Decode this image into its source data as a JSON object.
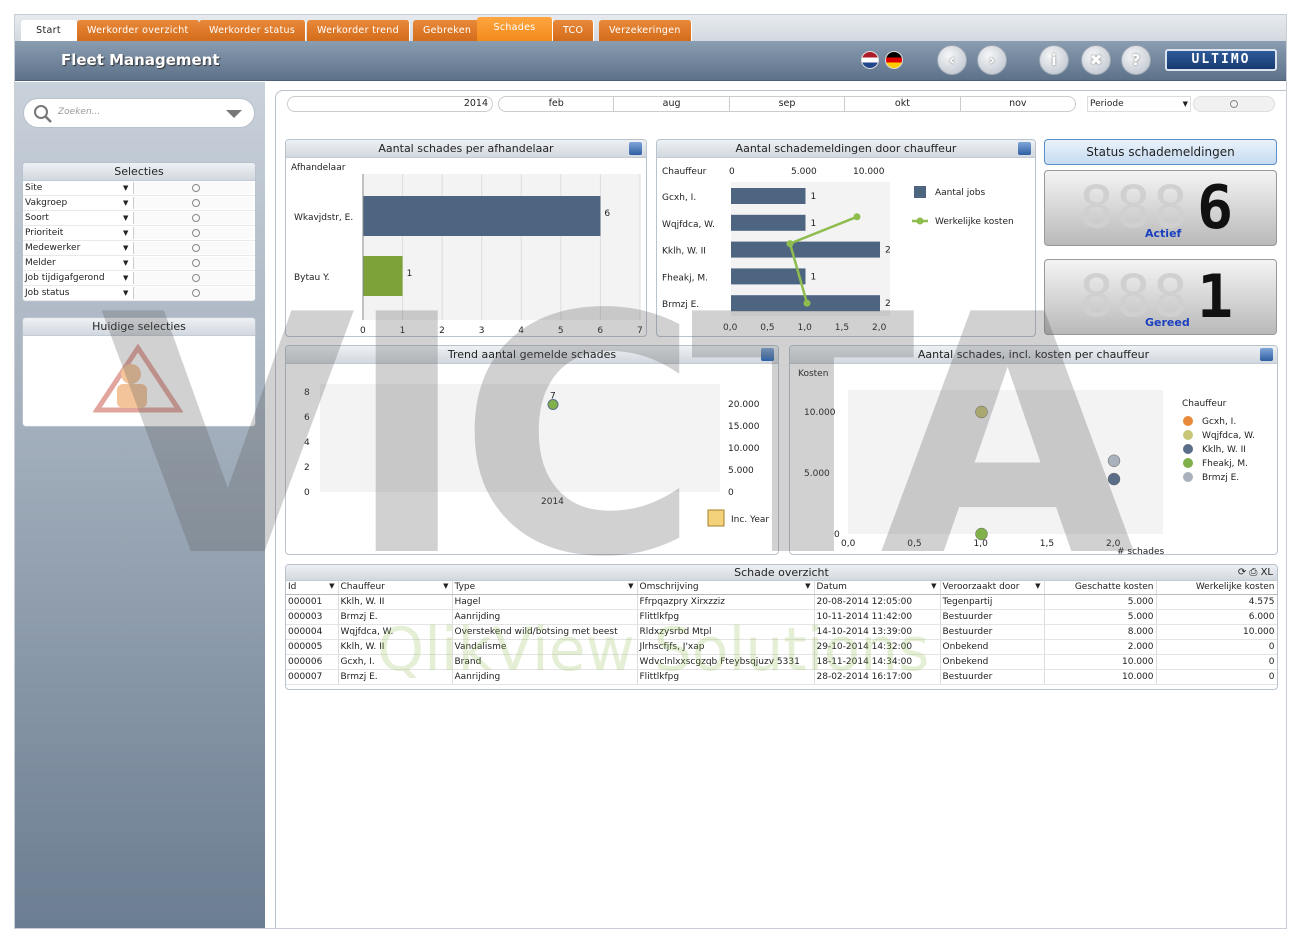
{
  "tabs": [
    "Start",
    "Werkorder overzicht",
    "Werkorder status",
    "Werkorder trend",
    "Gebreken",
    "Schades",
    "TCO",
    "Verzekeringen"
  ],
  "header": {
    "title": "Fleet Management",
    "brand": "ULTIMO"
  },
  "search": {
    "placeholder": "Zoeken..."
  },
  "selecties": {
    "title": "Selecties",
    "items": [
      "Site",
      "Vakgroep",
      "Soort",
      "Prioriteit",
      "Medewerker",
      "Melder",
      "Job tijdigafgerond",
      "Job status"
    ]
  },
  "huidige": {
    "title": "Huidige selecties"
  },
  "timeline": {
    "year": "2014",
    "months": [
      "feb",
      "aug",
      "sep",
      "okt",
      "nov"
    ],
    "periode": "Periode"
  },
  "status": {
    "title": "Status schademeldingen",
    "actief_label": "Actief",
    "actief_value": "6",
    "gereed_label": "Gereed",
    "gereed_value": "1"
  },
  "chart1": {
    "title": "Aantal schades per afhandelaar",
    "dim_label": "Afhandelaar",
    "chart_data": {
      "type": "bar",
      "orientation": "horizontal",
      "categories": [
        "Wkavjdstr, E.",
        "Bytau Y."
      ],
      "values": [
        6,
        1
      ],
      "xlim": [
        0,
        7
      ],
      "ticks": [
        "0",
        "1",
        "2",
        "3",
        "4",
        "5",
        "6",
        "7"
      ],
      "colors": [
        "#4e6582",
        "#7da23a"
      ]
    }
  },
  "chart2": {
    "title": "Aantal schademeldingen door chauffeur",
    "dim_label": "Chauffeur",
    "chart_data": {
      "type": "bar",
      "orientation": "horizontal",
      "categories": [
        "Gcxh, I.",
        "Wqjfdca, W.",
        "Kklh, W. II",
        "Fheakj, M.",
        "Brmzj E."
      ],
      "series": [
        {
          "name": "Aantal jobs",
          "values": [
            1,
            1,
            2,
            1,
            2
          ]
        },
        {
          "name": "Werkelijke kosten",
          "values": [
            null,
            10000,
            5000,
            null,
            0
          ]
        }
      ],
      "bottom_ticks": [
        "0,0",
        "0,5",
        "1,0",
        "1,5",
        "2,0"
      ],
      "top_ticks": [
        "0",
        "5.000",
        "10.000"
      ]
    }
  },
  "chart3": {
    "title": "Trend aantal gemelde schades",
    "chart_data": {
      "type": "scatter",
      "x": [
        "2014"
      ],
      "values": [
        7
      ],
      "left_ticks": [
        "0",
        "2",
        "4",
        "6",
        "8"
      ],
      "right_ticks": [
        "0",
        "5.000",
        "10.000",
        "15.000",
        "20.000"
      ]
    },
    "cycle_label": "Inc. Year"
  },
  "chart4": {
    "title": "Aantal schades, incl. kosten per chauffeur",
    "ylabel": "Kosten",
    "xlabel": "# schades",
    "legend_title": "Chauffeur",
    "chart_data": {
      "type": "scatter",
      "series": [
        {
          "name": "Gcxh, I.",
          "color": "#e9893a",
          "x": null,
          "y": null
        },
        {
          "name": "Wqjfdca, W.",
          "color": "#c9c67a",
          "x": 1,
          "y": 10000
        },
        {
          "name": "Kklh, W. II",
          "color": "#5a6e8a",
          "x": 2,
          "y": 4500
        },
        {
          "name": "Fheakj, M.",
          "color": "#7fb04a",
          "x": 1,
          "y": 0
        },
        {
          "name": "Brmzj E.",
          "color": "#a9b1bd",
          "x": 2,
          "y": 6000
        }
      ],
      "x_ticks": [
        "0,0",
        "0,5",
        "1,0",
        "1,5",
        "2,0"
      ],
      "y_ticks": [
        "0",
        "5.000",
        "10.000"
      ]
    }
  },
  "table": {
    "title": "Schade overzicht",
    "export_label": "XL",
    "columns": [
      "Id",
      "Chauffeur",
      "Type",
      "Omschrijving",
      "Datum",
      "Veroorzaakt door",
      "Geschatte kosten",
      "Werkelijke kosten"
    ],
    "rows": [
      [
        "000001",
        "Kklh, W. II",
        "Hagel",
        "Ffrpqazpry Xirxzziz",
        "20-08-2014 12:05:00",
        "Tegenpartij",
        "5.000",
        "4.575"
      ],
      [
        "000003",
        "Brmzj E.",
        "Aanrijding",
        "Flittlkfpg",
        "10-11-2014 11:42:00",
        "Bestuurder",
        "5.000",
        "6.000"
      ],
      [
        "000004",
        "Wqjfdca, W.",
        "Overstekend wild/botsing met beest",
        "Rldxzysrbd Mtpl",
        "14-10-2014 13:39:00",
        "Bestuurder",
        "8.000",
        "10.000"
      ],
      [
        "000005",
        "Kklh, W. II",
        "Vandalisme",
        "Jlrhscfjfs, J'xap",
        "29-10-2014 14:32:00",
        "Onbekend",
        "2.000",
        "0"
      ],
      [
        "000006",
        "Gcxh, I.",
        "Brand",
        "Wdvclnlxxscgzqb Fteybsqjuzv 5331",
        "18-11-2014 14:34:00",
        "Onbekend",
        "10.000",
        "0"
      ],
      [
        "000007",
        "Brmzj E.",
        "Aanrijding",
        "Flittlkfpg",
        "28-02-2014 16:17:00",
        "Bestuurder",
        "10.000",
        "0"
      ]
    ]
  },
  "watermark": {
    "big": "VICTA",
    "small": "QlikView Solutions"
  }
}
